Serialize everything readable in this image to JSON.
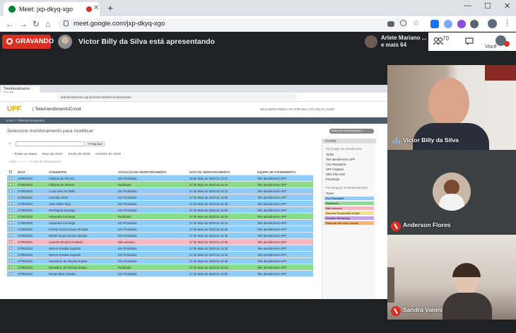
{
  "browser": {
    "tab_title": "Meet: jxp-dkyq-xgo",
    "url": "meet.google.com/jxp-dkyq-xgo",
    "new_tab": "+",
    "back": "←",
    "forward": "→",
    "reload": "↻",
    "home": "⌂",
    "minimize": "—",
    "maximize": "☐",
    "close": "✕"
  },
  "meet": {
    "recording_label": "GRAVANDO",
    "presenting_text": "Victor Billy da Silva está apresentando",
    "others_line1": "Arlete Mariano ...",
    "others_line2": "e mais 64",
    "people_count": "70",
    "you_label": "Você"
  },
  "shared_screen": {
    "tab_label": "TeleAtendimento Covid",
    "url": "teleatendimento.upf.br/sistema/telemonitoramento",
    "logo_upf": "UPF",
    "app_name": "| TeleAtendimentoCovid",
    "user_info": "SEJA BEM-VINDO, VICTOR BILLY DA SILVA | SAIR",
    "breadcrumb": "Início > Telemonitoramento",
    "page_title": "Selecione monitoramento para modificar",
    "modify_button": "Adicionar monitoramento +",
    "search_button": "Pesquisar",
    "months": [
      "‹ Todas as datas",
      "Maio de 2020",
      "Junho de 2020",
      "Outubro de 2020"
    ],
    "filter_row": "Ação: ------------  Ir   0 de 20 selecionados",
    "columns": [
      "DATA",
      "ATENDENTE",
      "SITUAÇÃO DO MONITORAMENTO",
      "DATA DO MONITORAMENTO",
      "EQUIPE DE ATENDIMENTO"
    ],
    "rows": [
      {
        "data": "15/05/2020",
        "atendente": "Fabiana de Oliveira",
        "situacao": "Em Prioridade",
        "data_mon": "28 de Maio de 2020 às 13:37",
        "equipe": "Tele atendimento UPF",
        "color": "#8ecdf7"
      },
      {
        "data": "27/05/2020",
        "atendente": "Fabiana de Oliveira",
        "situacao": "Realizado",
        "data_mon": "27 de Maio de 2020 às 13:44",
        "equipe": "Tele atendimento UPF",
        "color": "#8ed98a"
      },
      {
        "data": "27/05/2020",
        "atendente": "Lucia Aires de Mello",
        "situacao": "Em Prioridade",
        "data_mon": "27 de Maio de 2020 às 15:14",
        "equipe": "Tele atendimento UPF",
        "color": "#8ecdf7"
      },
      {
        "data": "27/05/2020",
        "atendente": "Amanda Vieira",
        "situacao": "Em Prioridade",
        "data_mon": "27 de Maio de 2020 às 15:08",
        "equipe": "Tele atendimento UPF",
        "color": "#8ecdf7"
      },
      {
        "data": "27/05/2020",
        "atendente": "João Milton Rigo",
        "situacao": "Em Prioridade",
        "data_mon": "27 de Maio de 2020 às 15:48",
        "equipe": "Tele atendimento UPF",
        "color": "#8ecdf7"
      },
      {
        "data": "27/05/2020",
        "atendente": "Rosângela Santiago",
        "situacao": "Em Prioridade",
        "data_mon": "27 de Maio de 2020 às 15:52",
        "equipe": "Tele atendimento UPF",
        "color": "#8ecdf7"
      },
      {
        "data": "27/05/2020",
        "atendente": "Alexandra Camargo",
        "situacao": "Realizado",
        "data_mon": "27 de Maio de 2020 às 15:16",
        "equipe": "Tele atendimento UPF",
        "color": "#8ed98a"
      },
      {
        "data": "27/05/2020",
        "atendente": "Alexandra Camargo",
        "situacao": "Em Prioridade",
        "data_mon": "27 de Maio de 2020 às 16:12",
        "equipe": "Tele atendimento UPF",
        "color": "#8ecdf7"
      },
      {
        "data": "27/05/2020",
        "atendente": "Priscila Souza Souza Almeida",
        "situacao": "Em Prioridade",
        "data_mon": "27 de Maio de 2020 às 16:28",
        "equipe": "Tele atendimento UPF",
        "color": "#8ecdf7"
      },
      {
        "data": "27/05/2020",
        "atendente": "Rafael Souza Souza Almeida",
        "situacao": "Em Prioridade",
        "data_mon": "27 de Maio de 2020 às 16:40",
        "equipe": "Tele atendimento UPF",
        "color": "#8ecdf7"
      },
      {
        "data": "27/05/2020",
        "atendente": "Leandro Ricardo Invaleski",
        "situacao": "Não atendeu",
        "data_mon": "27 de Maio de 2020 às 12:39",
        "equipe": "Tele atendimento UPF",
        "color": "#f5b8c4"
      },
      {
        "data": "27/05/2020",
        "atendente": "Nelson Rosalia Sagrado",
        "situacao": "Em Prioridade",
        "data_mon": "27 de Maio de 2020 às 13:32",
        "equipe": "Tele atendimento UPF",
        "color": "#8ecdf7"
      },
      {
        "data": "27/05/2020",
        "atendente": "Nelson Rosalia Sagrado",
        "situacao": "Em Prioridade",
        "data_mon": "27 de Maio de 2020 às 13:40",
        "equipe": "Tele atendimento UPF",
        "color": "#8ecdf7"
      },
      {
        "data": "27/05/2020",
        "atendente": "Daniela B. de Oliveira Zopetti",
        "situacao": "Em Prioridade",
        "data_mon": "27 de Maio de 2020 às 13:46",
        "equipe": "Tele atendimento UPF",
        "color": "#8ecdf7"
      },
      {
        "data": "27/05/2020",
        "atendente": "Daniela B. de Oliveira Zortea",
        "situacao": "Realizado",
        "data_mon": "27 de Maio de 2020 às 13:53",
        "equipe": "Tele atendimento UPF",
        "color": "#8ed98a"
      },
      {
        "data": "27/05/2020",
        "atendente": "Renan Elias Guedes",
        "situacao": "Em Prioridade",
        "data_mon": "27 de Maio de 2020 às 14:00",
        "equipe": "Tele atendimento UPF",
        "color": "#8ecdf7"
      }
    ],
    "filter_panel": {
      "title": "FILTRO",
      "section1": "Por Equipe de Atendimento",
      "section1_items": [
        "Todos",
        "Tele atendimento UPF",
        "Cas Psiquiatria",
        "UPF Hospital",
        "UBS São José",
        "Psicologia"
      ],
      "section2": "Por Situação do Monitoramento",
      "section2_items": [
        {
          "label": "Todos",
          "color": ""
        },
        {
          "label": "Em Prioridade",
          "color": "#8ecdf7"
        },
        {
          "label": "Realizado",
          "color": "#8ed98a"
        },
        {
          "label": "Não atendeu",
          "color": "#f5b8c4"
        },
        {
          "label": "Número Errado/Não Existe",
          "color": "#f8e08a"
        },
        {
          "label": "Enviado WhatsApp",
          "color": "#c9a0f0"
        },
        {
          "label": "Retornar em outro horário",
          "color": "#f8b070"
        }
      ]
    }
  },
  "participants": [
    {
      "name": "Victor Billy da Silva",
      "mic": "speaking"
    },
    {
      "name": "Anderson Flores",
      "mic": "muted"
    },
    {
      "name": "Sandra Vanini",
      "mic": "muted"
    }
  ]
}
